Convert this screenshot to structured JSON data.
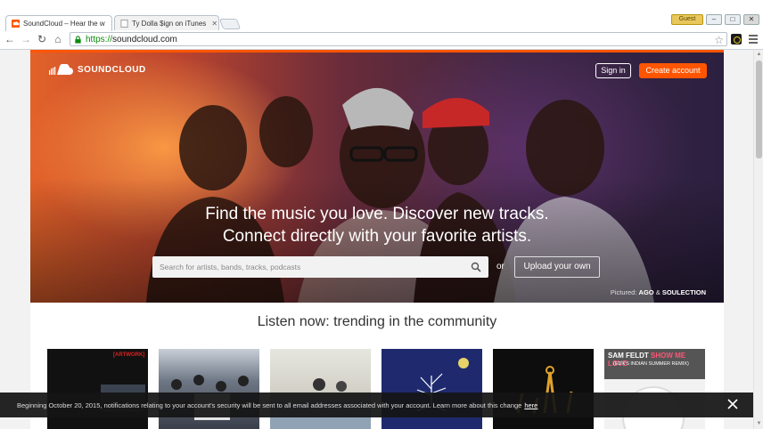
{
  "browser": {
    "tabs": [
      {
        "title": "SoundCloud – Hear the w",
        "active": true
      },
      {
        "title": "Ty Dolla $ign on iTunes",
        "active": false
      }
    ],
    "profile_label": "Guest",
    "url_scheme": "https://",
    "url_host": "soundcloud.com"
  },
  "header": {
    "brand": "SOUNDCLOUD",
    "signin_label": "Sign in",
    "create_label": "Create account",
    "accent": "#ff5500"
  },
  "hero": {
    "line1": "Find the music you love. Discover new tracks.",
    "line2": "Connect directly with your favorite artists.",
    "search_placeholder": "Search for artists, bands, tracks, podcasts",
    "or_label": "or",
    "upload_label": "Upload your own",
    "pictured_prefix": "Pictured:",
    "pictured_name1": "AGO",
    "pictured_amp": "&",
    "pictured_name2": "SOULECTION"
  },
  "trending": {
    "title": "Listen now: trending in the community",
    "tiles": [
      {
        "label": "[ARTWORK]"
      },
      {
        "label": ""
      },
      {
        "label": ""
      },
      {
        "label": ""
      },
      {
        "label": ""
      },
      {
        "artist": "SAM FELDT",
        "song": "SHOW ME LOVE",
        "sub": "(EDX'S INDIAN SUMMER REMIX)"
      }
    ]
  },
  "notice": {
    "text": "Beginning October 20, 2015, notifications relating to your account's security will be sent to all email addresses associated with your account. Learn more about this change",
    "link": "here"
  }
}
